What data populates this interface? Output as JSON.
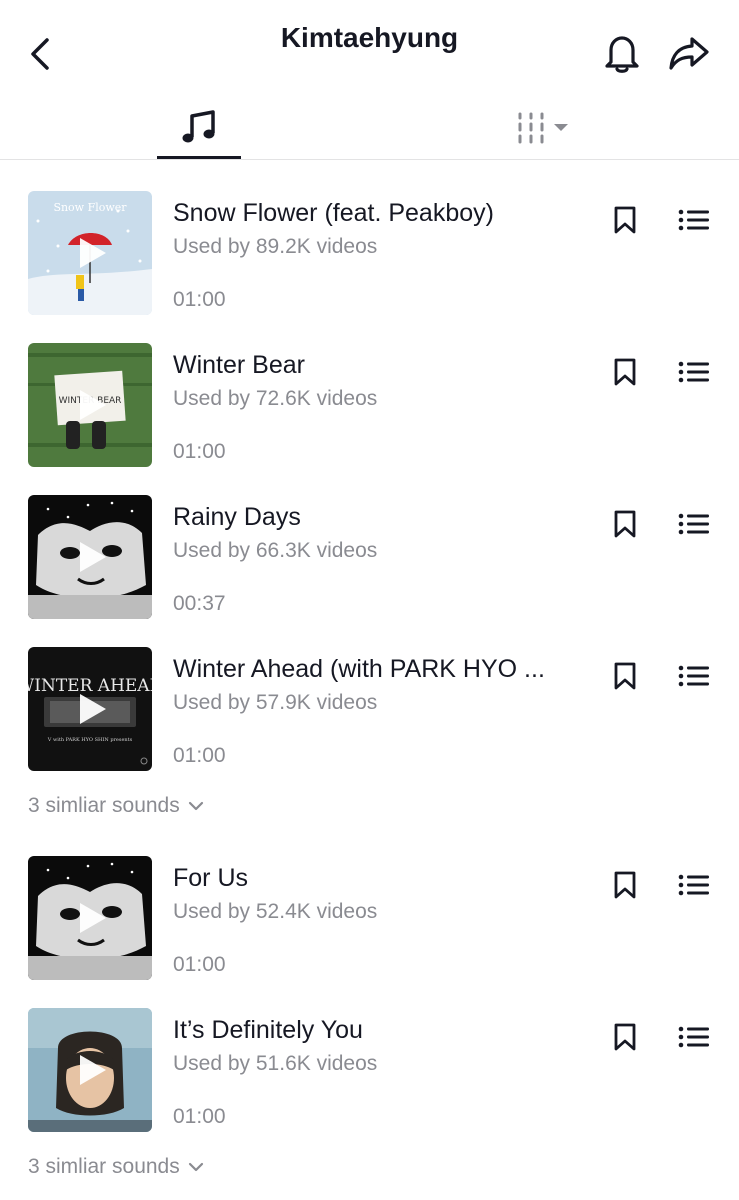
{
  "header": {
    "title": "Kimtaehyung",
    "back_icon": "chevron-left-icon",
    "bell_icon": "bell-icon",
    "share_icon": "share-arrow-icon"
  },
  "tabs": {
    "sounds_icon": "music-note-icon",
    "filter_icon": "filter-columns-icon"
  },
  "songs": [
    {
      "title": "Snow Flower (feat. Peakboy)",
      "usage": "Used by 89.2K videos",
      "duration": "01:00",
      "art_text": "Snow Flower"
    },
    {
      "title": "Winter Bear",
      "usage": "Used by 72.6K videos",
      "duration": "01:00",
      "art_text": "WINTER BEAR"
    },
    {
      "title": "Rainy Days",
      "usage": "Used by 66.3K videos",
      "duration": "00:37"
    },
    {
      "title": "Winter Ahead (with PARK HYO ...",
      "usage": "Used by 57.9K videos",
      "duration": "01:00",
      "art_text": "WINTER AHEAD",
      "art_subtext": "V with PARK HYO SHIN presents"
    },
    {
      "title": "For Us",
      "usage": "Used by 52.4K videos",
      "duration": "01:00"
    },
    {
      "title": "It’s Definitely You",
      "usage": "Used by 51.6K videos",
      "duration": "01:00"
    }
  ],
  "similar": [
    {
      "label": "3 simliar sounds"
    },
    {
      "label": "3 simliar sounds"
    }
  ],
  "colors": {
    "text_primary": "#161823",
    "text_secondary": "#8a8b91",
    "divider": "#e3e3e4"
  }
}
